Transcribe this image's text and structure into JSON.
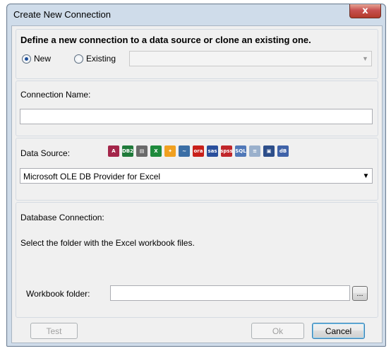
{
  "window": {
    "title": "Create New Connection",
    "close_icon": "close-x-icon",
    "close_glyph": "x"
  },
  "connection_type": {
    "heading": "Define a new connection to a data source or clone an existing one.",
    "new_label": "New",
    "existing_label": "Existing",
    "selected": "New",
    "existing_value": ""
  },
  "connection_name": {
    "label": "Connection Name:",
    "value": ""
  },
  "data_source": {
    "label": "Data Source:",
    "selected": "Microsoft OLE DB Provider for Excel",
    "icons": [
      {
        "name": "access-icon",
        "text": "A",
        "bg": "#a4264a"
      },
      {
        "name": "db2-icon",
        "text": "DB2",
        "bg": "#1f7a3a"
      },
      {
        "name": "dbase-icon",
        "text": "▤",
        "bg": "#6a6a6a"
      },
      {
        "name": "excel-icon",
        "text": "X",
        "bg": "#1e8a3c"
      },
      {
        "name": "firebird-icon",
        "text": "✦",
        "bg": "#f0a020"
      },
      {
        "name": "mysql-icon",
        "text": "~",
        "bg": "#3b6ea5"
      },
      {
        "name": "oracle-icon",
        "text": "ora",
        "bg": "#c8201a"
      },
      {
        "name": "sas-icon",
        "text": "sas",
        "bg": "#2a4f9c"
      },
      {
        "name": "spss-icon",
        "text": "spss",
        "bg": "#c0262b"
      },
      {
        "name": "sql-server-icon",
        "text": "SQL",
        "bg": "#5078b8"
      },
      {
        "name": "text-file-icon",
        "text": "≡",
        "bg": "#9ab0cc"
      },
      {
        "name": "odbc-icon",
        "text": "▣",
        "bg": "#2d4e8a"
      },
      {
        "name": "dbase-file-icon",
        "text": "dB",
        "bg": "#3f62a8"
      }
    ]
  },
  "database_connection": {
    "label": "Database Connection:",
    "instruction": "Select the folder with the Excel workbook files.",
    "folder_label": "Workbook folder:",
    "folder_value": "",
    "browse_label": "..."
  },
  "buttons": {
    "test": "Test",
    "ok": "Ok",
    "cancel": "Cancel"
  }
}
